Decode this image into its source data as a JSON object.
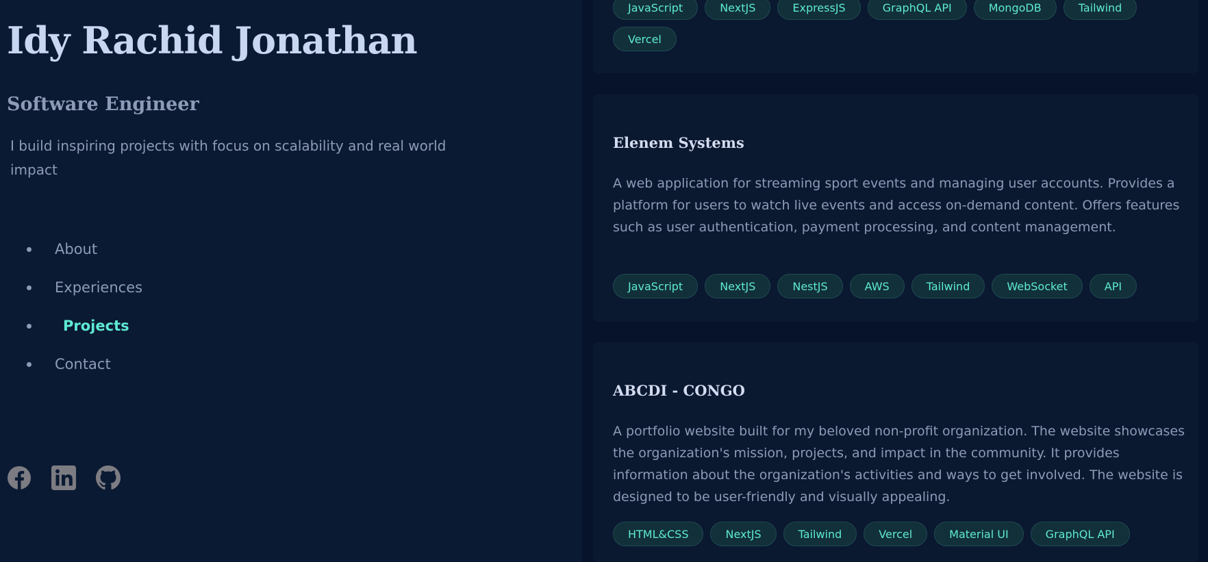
{
  "profile": {
    "name": "Idy Rachid Jonathan",
    "role": "Software Engineer",
    "tagline": "I build inspiring projects with focus on scalability and real world impact"
  },
  "nav": {
    "items": [
      {
        "label": "About",
        "active": false
      },
      {
        "label": "Experiences",
        "active": false
      },
      {
        "label": "Projects",
        "active": true
      },
      {
        "label": "Contact",
        "active": false
      }
    ]
  },
  "socials": [
    {
      "icon": "facebook-icon"
    },
    {
      "icon": "linkedin-icon"
    },
    {
      "icon": "github-icon"
    }
  ],
  "projects": [
    {
      "title": "",
      "description": "",
      "tags": [
        "JavaScript",
        "NextJS",
        "ExpressJS",
        "GraphQL API",
        "MongoDB",
        "Tailwind",
        "Vercel"
      ]
    },
    {
      "title": "Elenem Systems",
      "description": "A web application for streaming sport events and managing user accounts. Provides a platform for users to watch live events and access on-demand content. Offers features such as user authentication, payment processing, and content management.",
      "tags": [
        "JavaScript",
        "NextJS",
        "NestJS",
        "AWS",
        "Tailwind",
        "WebSocket",
        "API"
      ]
    },
    {
      "title": "ABCDI - CONGO",
      "description": "A portfolio website built for my beloved non-profit organization. The website showcases the organization's mission, projects, and impact in the community. It provides information about the organization's activities and ways to get involved. The website is designed to be user-friendly and visually appealing.",
      "tags": [
        "HTML&CSS",
        "NextJS",
        "Tailwind",
        "Vercel",
        "Material UI",
        "GraphQL API"
      ]
    }
  ],
  "colors": {
    "accent": "#5eead4",
    "text_muted": "#8e9bb8",
    "heading": "#c9d6f2",
    "bg_left": "#0b1a33",
    "bg_right": "#07132a"
  }
}
